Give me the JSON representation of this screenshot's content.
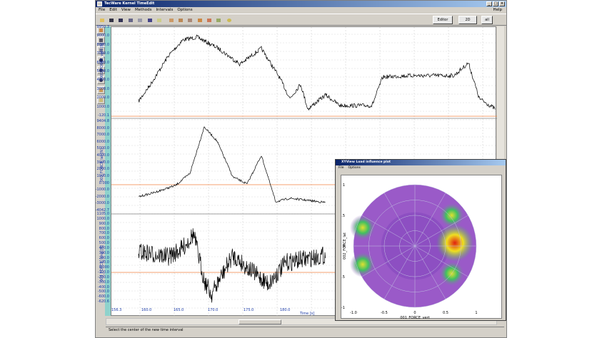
{
  "window": {
    "title": "TecWare Kernel TimeEdit"
  },
  "menu": {
    "items": [
      "File",
      "Edit",
      "View",
      "Methods",
      "Intervals",
      "Options"
    ],
    "help": "Help"
  },
  "toolbar": {
    "btn_editor": "Editor",
    "btn_2d": "2D",
    "btn_all": "all"
  },
  "plots": {
    "p1": {
      "ylabel": "001_FORCE_vert [N]",
      "ticks": [
        "9950.3",
        "9000.0",
        "8000.0",
        "7000.0",
        "6000.0",
        "5000.0",
        "4000.0",
        "3000.0",
        "2000.0",
        "1000.0",
        "-120.1"
      ]
    },
    "p2": {
      "ylabel": "002_FORCE_lat [N]",
      "ticks": [
        "9404.8",
        "8000.0",
        "7000.0",
        "6000.0",
        "5000.0",
        "4000.0",
        "3000.0",
        "2000.0",
        "1000.0",
        "0.000",
        "-1000.0",
        "-2000.0",
        "-3000.0",
        "-4042.7"
      ]
    },
    "p3": {
      "ylabel": "003_FORCE_long [N]",
      "ticks": [
        "1105.0",
        "1000.0",
        "900.0",
        "800.0",
        "700.0",
        "600.0",
        "500.0",
        "400.0",
        "300.0",
        "200.0",
        "100.0",
        "0.000",
        "-100.0",
        "-200.0",
        "-300.0",
        "-400.0",
        "-500.0",
        "-600.0",
        "-620.6"
      ]
    }
  },
  "xaxis": {
    "ticks": [
      "156.3",
      "160.0",
      "165.0",
      "170.0",
      "175.0",
      "180.0"
    ],
    "label": "Time [s]"
  },
  "status": {
    "text": "Select the center of the new time interval"
  },
  "popup": {
    "title": "XYView Load influence plot",
    "menu": [
      "File",
      "Options"
    ],
    "chart": {
      "ylabel": "002_FORCE_lat",
      "xlabel": "001_FORCE_vert",
      "xticks": [
        "-1.0",
        "-0.5",
        "0",
        "0.5",
        "1"
      ],
      "yticks": [
        "1",
        "0.5",
        "0",
        "-0.5",
        "-1"
      ]
    }
  },
  "chart_data": {
    "type": "heatmap",
    "title": "",
    "xlabel": "001_FORCE_vert",
    "ylabel": "002_FORCE_lat",
    "xlim": [
      -1,
      1
    ],
    "ylim": [
      -1,
      1
    ],
    "grid": "polar",
    "hotspots": [
      {
        "x": 0.65,
        "y": 0.05,
        "level": "high"
      },
      {
        "x": -0.85,
        "y": 0.3,
        "level": "medium"
      },
      {
        "x": -0.85,
        "y": -0.3,
        "level": "medium"
      },
      {
        "x": 0.6,
        "y": 0.5,
        "level": "medium"
      },
      {
        "x": 0.6,
        "y": -0.45,
        "level": "medium"
      }
    ],
    "colors": {
      "low": "#4a2a8a",
      "mid": "#9a5ac8",
      "high": "#e02010"
    }
  }
}
